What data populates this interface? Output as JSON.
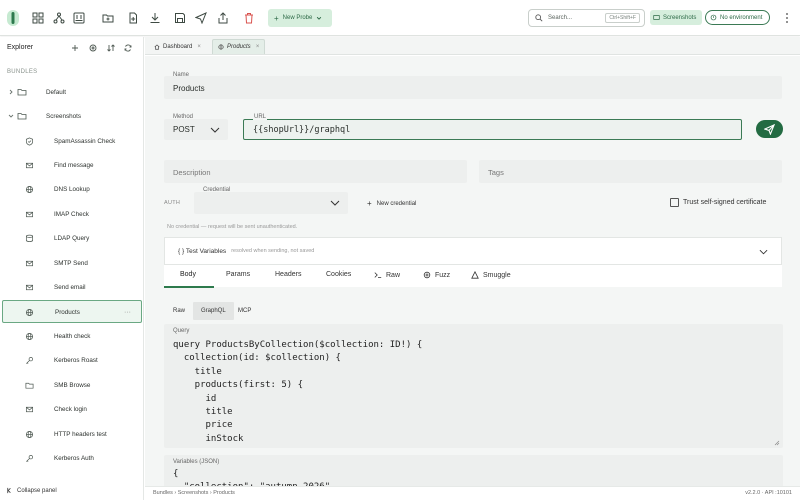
{
  "toolbar": {
    "new_probe_label": "New Probe",
    "search_placeholder": "Search...",
    "search_shortcut": "Ctrl+Shift+F",
    "screenshots_chip": "Screenshots",
    "environment_chip": "No environment"
  },
  "sidebar": {
    "title": "Explorer",
    "section_label": "BUNDLES",
    "bundles": [
      {
        "label": "Default",
        "expanded": false
      },
      {
        "label": "Screenshots",
        "expanded": true
      }
    ],
    "items": [
      {
        "label": "SpamAssassin Check",
        "icon": "shield-check-icon"
      },
      {
        "label": "Find message",
        "icon": "envelope-icon"
      },
      {
        "label": "DNS Lookup",
        "icon": "globe-icon"
      },
      {
        "label": "IMAP Check",
        "icon": "envelope-icon"
      },
      {
        "label": "LDAP Query",
        "icon": "database-icon"
      },
      {
        "label": "SMTP Send",
        "icon": "envelope-icon"
      },
      {
        "label": "Send email",
        "icon": "envelope-icon"
      },
      {
        "label": "Products",
        "icon": "globe-icon",
        "active": true
      },
      {
        "label": "Health check",
        "icon": "globe-icon"
      },
      {
        "label": "Kerberos Roast",
        "icon": "key-icon"
      },
      {
        "label": "SMB Browse",
        "icon": "folder-icon"
      },
      {
        "label": "Check login",
        "icon": "envelope-icon"
      },
      {
        "label": "HTTP headers test",
        "icon": "globe-icon"
      },
      {
        "label": "Kerberos Auth",
        "icon": "key-icon"
      }
    ],
    "collapse_label": "Collapse panel"
  },
  "tabs": [
    {
      "label": "Dashboard",
      "icon": "home-icon",
      "active": false
    },
    {
      "label": "Products",
      "icon": "globe-icon",
      "active": true
    }
  ],
  "form": {
    "name_label": "Name",
    "name_value": "Products",
    "method_label": "Method",
    "method_value": "POST",
    "url_label": "URL",
    "url_value": "{{shopUrl}}/graphql",
    "description_placeholder": "Description",
    "tags_placeholder": "Tags",
    "auth_label": "AUTH",
    "credential_label": "Credential",
    "new_credential_label": "New credential",
    "trust_cert_label": "Trust self-signed certificate",
    "trust_cert_checked": false,
    "no_credential_note": "No credential — request will be sent unauthenticated."
  },
  "test_variables": {
    "title": "{ } Test Variables",
    "hint": "resolved when sending, not saved"
  },
  "request_tabs": [
    {
      "label": "Body",
      "active": true
    },
    {
      "label": "Params"
    },
    {
      "label": "Headers"
    },
    {
      "label": "Cookies"
    },
    {
      "label": "Raw"
    },
    {
      "label": "Fuzz"
    },
    {
      "label": "Smuggle"
    }
  ],
  "body_tabs": [
    {
      "label": "Raw"
    },
    {
      "label": "GraphQL",
      "active": true
    },
    {
      "label": "MCP"
    }
  ],
  "query": {
    "label": "Query",
    "code": "query ProductsByCollection($collection: ID!) {\n  collection(id: $collection) {\n    title\n    products(first: 5) {\n      id\n      title\n      price\n      inStock"
  },
  "variables": {
    "label": "Variables (JSON)",
    "code": "{\n  \"collection\": \"autumn-2026\""
  },
  "status": {
    "breadcrumb": "Bundles › Screenshots › Products",
    "version": "v2.2.0 · API :10101"
  },
  "colors": {
    "accent": "#236b42",
    "accent_light": "#d6eedd",
    "delete": "#d9534f"
  }
}
